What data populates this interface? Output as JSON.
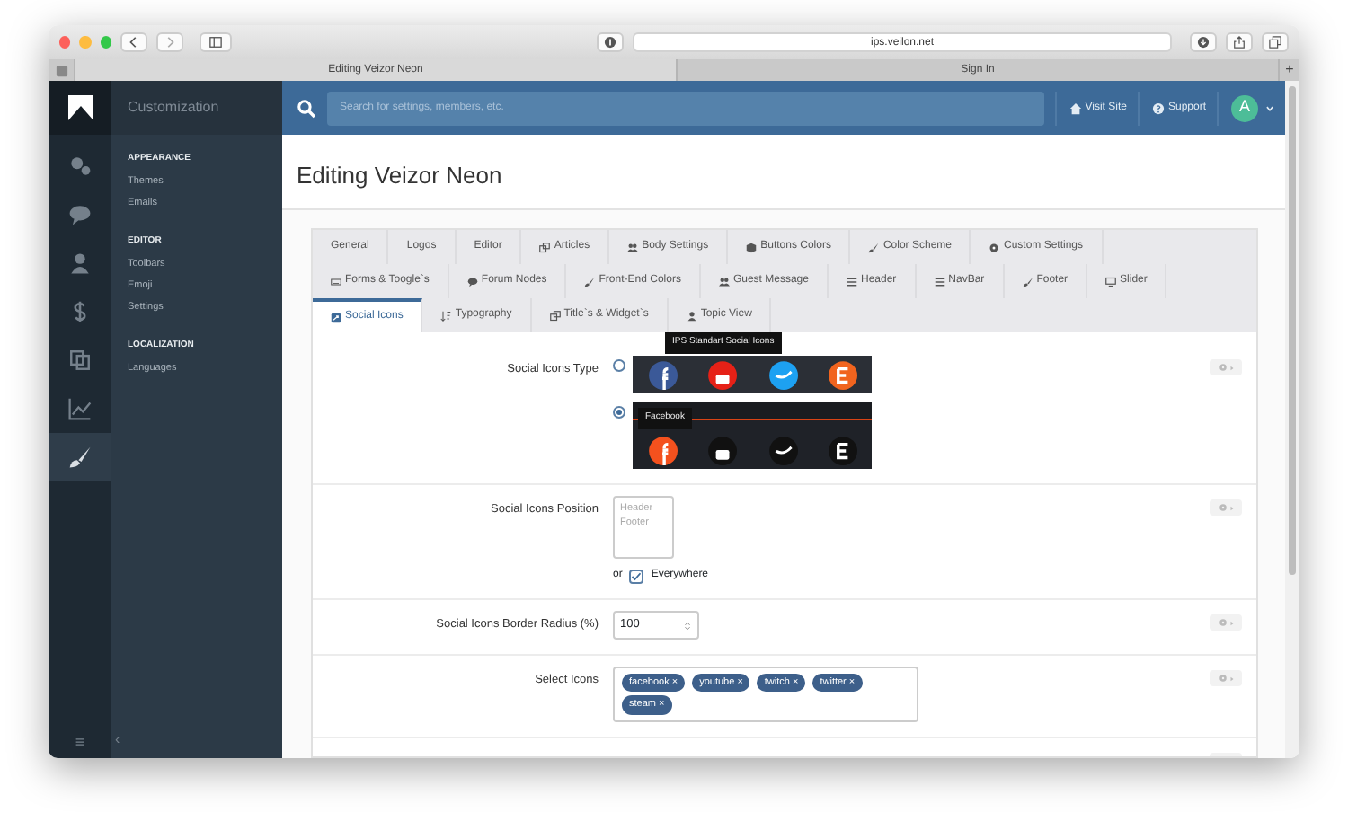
{
  "browser": {
    "url": "ips.veilon.net",
    "tabs": [
      {
        "title": "Editing Veizor Neon",
        "selected": true
      },
      {
        "title": "Sign In",
        "selected": false
      }
    ],
    "new_tab": "+"
  },
  "rail": {
    "items": [
      {
        "kind": "gears",
        "selected": false
      },
      {
        "kind": "chat",
        "selected": false
      },
      {
        "kind": "user",
        "selected": false
      },
      {
        "kind": "dollar",
        "selected": false
      },
      {
        "kind": "copy",
        "selected": false
      },
      {
        "kind": "chart",
        "selected": false
      },
      {
        "kind": "brush",
        "selected": true
      }
    ],
    "menu": "≡"
  },
  "sidebar": {
    "title": "Customization",
    "sections": [
      {
        "heading": "APPEARANCE",
        "items": [
          "Themes",
          "Emails"
        ]
      },
      {
        "heading": "EDITOR",
        "items": [
          "Toolbars",
          "Emoji",
          "Settings"
        ]
      },
      {
        "heading": "LOCALIZATION",
        "items": [
          "Languages"
        ]
      }
    ],
    "collapse": "‹"
  },
  "topbar": {
    "search_placeholder": "Search for settings, members, etc.",
    "links": [
      {
        "kind": "home",
        "label": "Visit Site"
      },
      {
        "kind": "help",
        "label": "Support"
      }
    ],
    "avatar": "A"
  },
  "page_title": "Editing Veizor Neon",
  "tab_rows": [
    [
      {
        "label": "General",
        "kind": "plain",
        "selected": false
      },
      {
        "label": "Logos",
        "kind": "plain",
        "selected": false
      },
      {
        "label": "Editor",
        "kind": "plain",
        "selected": false
      },
      {
        "label": "Articles",
        "kind": "windows",
        "selected": false
      },
      {
        "label": "Body Settings",
        "kind": "users",
        "selected": false
      },
      {
        "label": "Buttons Colors",
        "kind": "cube",
        "selected": false
      },
      {
        "label": "Color Scheme",
        "kind": "brush",
        "selected": false
      },
      {
        "label": "Custom Settings",
        "kind": "gear",
        "selected": false
      }
    ],
    [
      {
        "label": "Forms & Toogle`s",
        "kind": "keyboard",
        "selected": false
      },
      {
        "label": "Forum Nodes",
        "kind": "chat",
        "selected": false
      },
      {
        "label": "Front-End Colors",
        "kind": "brush",
        "selected": false
      },
      {
        "label": "Guest Message",
        "kind": "users",
        "selected": false
      },
      {
        "label": "Header",
        "kind": "bars",
        "selected": false
      },
      {
        "label": "NavBar",
        "kind": "bars",
        "selected": false
      },
      {
        "label": "Footer",
        "kind": "brush",
        "selected": false
      },
      {
        "label": "Slider",
        "kind": "monitor",
        "selected": false
      }
    ],
    [
      {
        "label": "Social Icons",
        "kind": "share",
        "selected": true
      },
      {
        "label": "Typography",
        "kind": "sort",
        "selected": false
      },
      {
        "label": "Title`s & Widget`s",
        "kind": "windows",
        "selected": false
      },
      {
        "label": "Topic View",
        "kind": "user",
        "selected": false
      }
    ]
  ],
  "form": [
    {
      "kind": "radio-images",
      "label": "Social Icons Type",
      "options": [
        {
          "kind": "flat",
          "selected": false,
          "tooltip": "IPS Standart Social Icons"
        },
        {
          "kind": "dark",
          "selected": true,
          "tooltip": "Facebook"
        }
      ]
    },
    {
      "kind": "listbox",
      "label": "Social Icons Position",
      "options": [
        {
          "label": "Header",
          "selected": false
        },
        {
          "label": "Footer",
          "selected": false
        }
      ],
      "or": "or",
      "everywhere": {
        "label": "Everywhere",
        "checked": true
      }
    },
    {
      "kind": "number",
      "label": "Social Icons Border Radius (%)",
      "value": "100"
    },
    {
      "kind": "tags",
      "label": "Select Icons",
      "tags": [
        {
          "label": "facebook",
          "remove": "×"
        },
        {
          "label": "youtube",
          "remove": "×"
        },
        {
          "label": "twitch",
          "remove": "×"
        },
        {
          "label": "twitter",
          "remove": "×"
        },
        {
          "label": "steam",
          "remove": "×"
        }
      ]
    }
  ]
}
